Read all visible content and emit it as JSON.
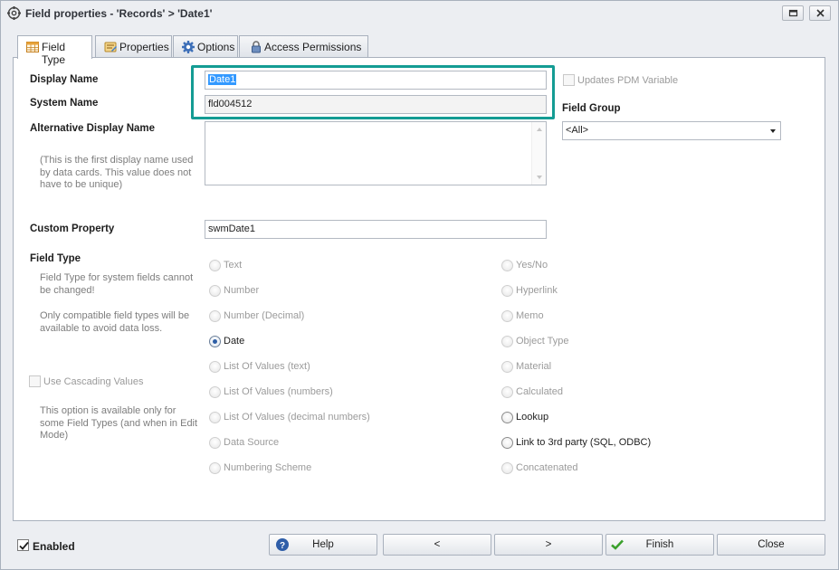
{
  "window": {
    "title": "Field properties - 'Records' > 'Date1'",
    "icons": {
      "app": "field-properties-icon",
      "maximize": "restore-icon",
      "close": "close-icon"
    }
  },
  "tabs": [
    {
      "label": "Field Type",
      "icon": "table-icon",
      "active": true
    },
    {
      "label": "Properties",
      "icon": "properties-icon",
      "active": false
    },
    {
      "label": "Options",
      "icon": "gear-icon",
      "active": false
    },
    {
      "label": "Access Permissions",
      "icon": "lock-icon",
      "active": false
    }
  ],
  "form": {
    "display_name_label": "Display Name",
    "display_name_value": "Date1",
    "system_name_label": "System Name",
    "system_name_value": "fld004512",
    "alt_display_name_label": "Alternative Display Name",
    "alt_display_name_hint": "(This is the first display name used by data cards. This value does not have to be unique)",
    "alt_display_name_value": "",
    "updates_pdm_label": "Updates PDM Variable",
    "field_group_label": "Field Group",
    "field_group_value": "<All>",
    "custom_property_label": "Custom Property",
    "custom_property_value": "swmDate1",
    "field_type_label": "Field Type",
    "field_type_hint1": "Field Type for system fields cannot be changed!",
    "field_type_hint2": "Only compatible field types will be available to avoid data loss.",
    "cascading_label": "Use Cascading Values",
    "cascading_hint": "This option is available only for some Field Types (and when in Edit Mode)"
  },
  "field_types_left": [
    {
      "label": "Text",
      "state": "disabled"
    },
    {
      "label": "Number",
      "state": "disabled"
    },
    {
      "label": "Number (Decimal)",
      "state": "disabled"
    },
    {
      "label": "Date",
      "state": "checked"
    },
    {
      "label": "List Of Values (text)",
      "state": "disabled"
    },
    {
      "label": "List Of Values (numbers)",
      "state": "disabled"
    },
    {
      "label": "List Of Values (decimal numbers)",
      "state": "disabled"
    },
    {
      "label": "Data Source",
      "state": "disabled"
    },
    {
      "label": "Numbering Scheme",
      "state": "disabled"
    }
  ],
  "field_types_right": [
    {
      "label": "Yes/No",
      "state": "disabled"
    },
    {
      "label": "Hyperlink",
      "state": "disabled"
    },
    {
      "label": "Memo",
      "state": "disabled"
    },
    {
      "label": "Object Type",
      "state": "disabled"
    },
    {
      "label": "Material",
      "state": "disabled"
    },
    {
      "label": "Calculated",
      "state": "disabled"
    },
    {
      "label": "Lookup",
      "state": "enabled"
    },
    {
      "label": "Link to 3rd party (SQL, ODBC)",
      "state": "enabled"
    },
    {
      "label": "Concatenated",
      "state": "disabled"
    }
  ],
  "footer": {
    "enabled_label": "Enabled",
    "enabled_checked": true,
    "help_label": "Help",
    "back_label": "<",
    "next_label": ">",
    "finish_label": "Finish",
    "close_label": "Close"
  },
  "colors": {
    "highlight": "#149c94",
    "selection": "#3399ff",
    "radio_dot": "#2d5ea6",
    "finish_check": "#3aa02c"
  }
}
